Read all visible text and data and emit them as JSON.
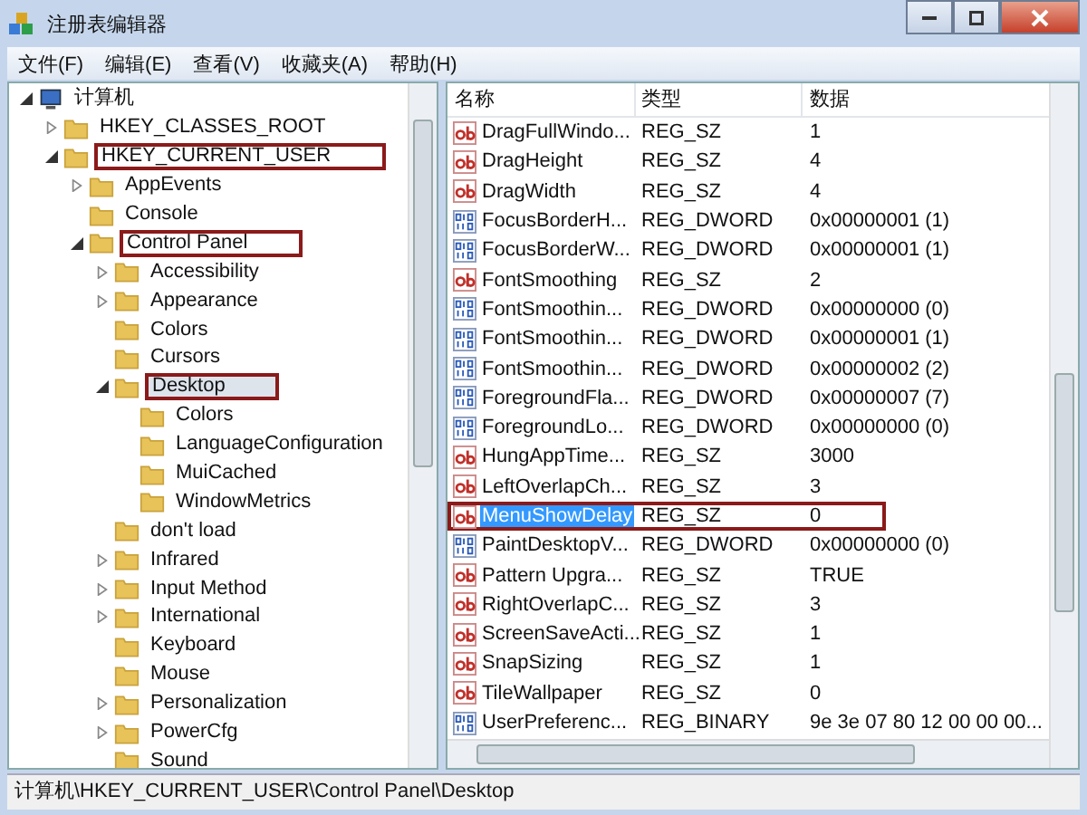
{
  "window": {
    "title": "注册表编辑器"
  },
  "menu": [
    "文件(F)",
    "编辑(E)",
    "查看(V)",
    "收藏夹(A)",
    "帮助(H)"
  ],
  "tree": {
    "label": "计算机",
    "expanded": true,
    "highlighted": false,
    "selected": false,
    "children": [
      {
        "label": "HKEY_CLASSES_ROOT",
        "expanded": false,
        "highlighted": false,
        "selected": false
      },
      {
        "label": "HKEY_CURRENT_USER",
        "expanded": true,
        "highlighted": true,
        "selected": false,
        "children": [
          {
            "label": "AppEvents",
            "expanded": false,
            "highlighted": false,
            "selected": false
          },
          {
            "label": "Console",
            "highlighted": false,
            "selected": false
          },
          {
            "label": "Control Panel",
            "expanded": true,
            "highlighted": true,
            "selected": false,
            "children": [
              {
                "label": "Accessibility",
                "expanded": false,
                "highlighted": false,
                "selected": false
              },
              {
                "label": "Appearance",
                "expanded": false,
                "highlighted": false,
                "selected": false
              },
              {
                "label": "Colors",
                "highlighted": false,
                "selected": false
              },
              {
                "label": "Cursors",
                "highlighted": false,
                "selected": false
              },
              {
                "label": "Desktop",
                "expanded": true,
                "highlighted": true,
                "selected": true,
                "children": [
                  {
                    "label": "Colors",
                    "highlighted": false,
                    "selected": false
                  },
                  {
                    "label": "LanguageConfiguration",
                    "highlighted": false,
                    "selected": false
                  },
                  {
                    "label": "MuiCached",
                    "highlighted": false,
                    "selected": false
                  },
                  {
                    "label": "WindowMetrics",
                    "highlighted": false,
                    "selected": false
                  }
                ]
              },
              {
                "label": "don't load",
                "highlighted": false,
                "selected": false
              },
              {
                "label": "Infrared",
                "expanded": false,
                "highlighted": false,
                "selected": false
              },
              {
                "label": "Input Method",
                "expanded": false,
                "highlighted": false,
                "selected": false
              },
              {
                "label": "International",
                "expanded": false,
                "highlighted": false,
                "selected": false
              },
              {
                "label": "Keyboard",
                "highlighted": false,
                "selected": false
              },
              {
                "label": "Mouse",
                "highlighted": false,
                "selected": false
              },
              {
                "label": "Personalization",
                "expanded": false,
                "highlighted": false,
                "selected": false
              },
              {
                "label": "PowerCfg",
                "expanded": false,
                "highlighted": false,
                "selected": false
              },
              {
                "label": "Sound",
                "highlighted": false,
                "selected": false
              }
            ]
          }
        ]
      }
    ]
  },
  "values": {
    "columns": [
      "名称",
      "类型",
      "数据"
    ],
    "rows": [
      {
        "kind": "string",
        "name": "DragFullWindo...",
        "type": "REG_SZ",
        "data": "1",
        "selected": false,
        "highlighted": false
      },
      {
        "kind": "string",
        "name": "DragHeight",
        "type": "REG_SZ",
        "data": "4",
        "selected": false,
        "highlighted": false
      },
      {
        "kind": "string",
        "name": "DragWidth",
        "type": "REG_SZ",
        "data": "4",
        "selected": false,
        "highlighted": false
      },
      {
        "kind": "binary",
        "name": "FocusBorderH...",
        "type": "REG_DWORD",
        "data": "0x00000001 (1)",
        "selected": false,
        "highlighted": false
      },
      {
        "kind": "binary",
        "name": "FocusBorderW...",
        "type": "REG_DWORD",
        "data": "0x00000001 (1)",
        "selected": false,
        "highlighted": false
      },
      {
        "kind": "string",
        "name": "FontSmoothing",
        "type": "REG_SZ",
        "data": "2",
        "selected": false,
        "highlighted": false
      },
      {
        "kind": "binary",
        "name": "FontSmoothin...",
        "type": "REG_DWORD",
        "data": "0x00000000 (0)",
        "selected": false,
        "highlighted": false
      },
      {
        "kind": "binary",
        "name": "FontSmoothin...",
        "type": "REG_DWORD",
        "data": "0x00000001 (1)",
        "selected": false,
        "highlighted": false
      },
      {
        "kind": "binary",
        "name": "FontSmoothin...",
        "type": "REG_DWORD",
        "data": "0x00000002 (2)",
        "selected": false,
        "highlighted": false
      },
      {
        "kind": "binary",
        "name": "ForegroundFla...",
        "type": "REG_DWORD",
        "data": "0x00000007 (7)",
        "selected": false,
        "highlighted": false
      },
      {
        "kind": "binary",
        "name": "ForegroundLo...",
        "type": "REG_DWORD",
        "data": "0x00000000 (0)",
        "selected": false,
        "highlighted": false
      },
      {
        "kind": "string",
        "name": "HungAppTime...",
        "type": "REG_SZ",
        "data": "3000",
        "selected": false,
        "highlighted": false
      },
      {
        "kind": "string",
        "name": "LeftOverlapCh...",
        "type": "REG_SZ",
        "data": "3",
        "selected": false,
        "highlighted": false
      },
      {
        "kind": "string",
        "name": "MenuShowDelay",
        "type": "REG_SZ",
        "data": "0",
        "selected": true,
        "highlighted": true
      },
      {
        "kind": "binary",
        "name": "PaintDesktopV...",
        "type": "REG_DWORD",
        "data": "0x00000000 (0)",
        "selected": false,
        "highlighted": false
      },
      {
        "kind": "string",
        "name": "Pattern Upgra...",
        "type": "REG_SZ",
        "data": "TRUE",
        "selected": false,
        "highlighted": false
      },
      {
        "kind": "string",
        "name": "RightOverlapC...",
        "type": "REG_SZ",
        "data": "3",
        "selected": false,
        "highlighted": false
      },
      {
        "kind": "string",
        "name": "ScreenSaveActi...",
        "type": "REG_SZ",
        "data": "1",
        "selected": false,
        "highlighted": false
      },
      {
        "kind": "string",
        "name": "SnapSizing",
        "type": "REG_SZ",
        "data": "1",
        "selected": false,
        "highlighted": false
      },
      {
        "kind": "string",
        "name": "TileWallpaper",
        "type": "REG_SZ",
        "data": "0",
        "selected": false,
        "highlighted": false
      },
      {
        "kind": "binary",
        "name": "UserPreferenc...",
        "type": "REG_BINARY",
        "data": "9e 3e 07 80 12 00 00 00...",
        "selected": false,
        "highlighted": false
      }
    ]
  },
  "status_bar": "计算机\\HKEY_CURRENT_USER\\Control Panel\\Desktop"
}
